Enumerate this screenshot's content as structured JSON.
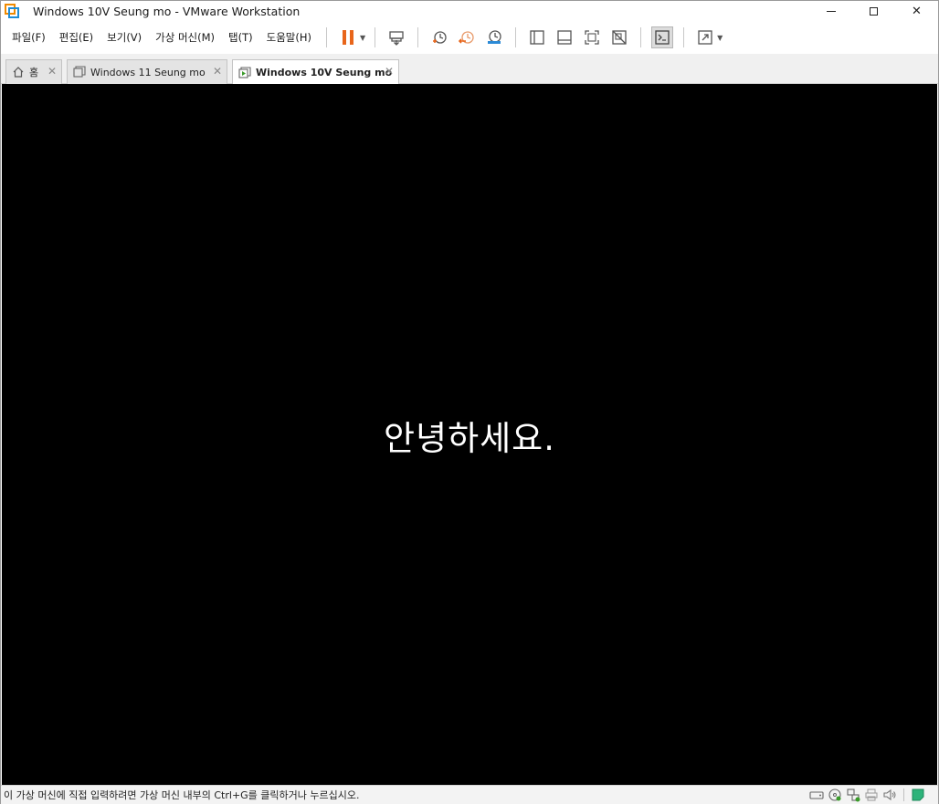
{
  "window": {
    "title": "Windows 10V Seung mo - VMware Workstation",
    "controls": {
      "minimize": "",
      "maximize": "",
      "close": "✕"
    }
  },
  "menu": {
    "items": [
      {
        "label": "파일(F)"
      },
      {
        "label": "편집(E)"
      },
      {
        "label": "보기(V)"
      },
      {
        "label": "가상 머신(M)"
      },
      {
        "label": "탭(T)"
      },
      {
        "label": "도움말(H)"
      }
    ]
  },
  "toolbar": {
    "icons": [
      "pause-icon",
      "send-ctrl-alt-del-icon",
      "snapshot-take-icon",
      "snapshot-revert-icon",
      "snapshot-manager-icon",
      "library-view-icon",
      "thumbnail-bar-icon",
      "full-screen-icon",
      "unity-icon",
      "console-view-icon",
      "stretch-guest-icon"
    ],
    "colors": {
      "pause": "#e8651a",
      "snapshot": "#e8651a"
    }
  },
  "tabs": [
    {
      "label": "홈",
      "icon": "home-icon",
      "active": false
    },
    {
      "label": "Windows 11 Seung mo",
      "icon": "vm-icon",
      "active": false
    },
    {
      "label": "Windows 10V Seung mo",
      "icon": "vm-running-icon",
      "active": true
    }
  ],
  "vm": {
    "screen_text": "안녕하세요.",
    "background": "#000000"
  },
  "status": {
    "message": "이 가상 머신에 직접 입력하려면 가상 머신 내부의 Ctrl+G를 클릭하거나 누르십시오.",
    "icons": [
      "hard-disk-icon",
      "cd-dvd-icon",
      "network-icon",
      "printer-icon",
      "sound-icon",
      "message-log-icon"
    ]
  }
}
